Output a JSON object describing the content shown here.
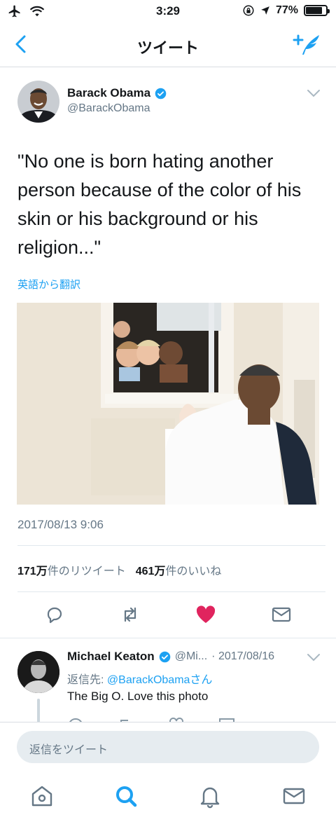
{
  "status": {
    "time": "3:29",
    "battery": "77%",
    "battery_level": 0.77
  },
  "nav": {
    "title": "ツイート"
  },
  "tweet": {
    "author_name": "Barack Obama",
    "author_handle": "@BarackObama",
    "text": "\"No one is born hating another person because of the color of his skin or his background or his religion...\"",
    "translate_label": "英語から翻訳",
    "timestamp": "2017/08/13 9:06",
    "retweets_count": "171万",
    "retweets_label": "件のリツイート",
    "likes_count": "461万",
    "likes_label": "件のいいね"
  },
  "reply": {
    "author_name": "Michael Keaton",
    "handle_truncated": "@Mi...",
    "date": "· 2017/08/16",
    "reply_prefix": "返信先: ",
    "reply_mention": "@BarackObamaさん",
    "text": "The Big O. Love this photo"
  },
  "composer": {
    "placeholder": "返信をツイート"
  },
  "colors": {
    "accent": "#1da1f2",
    "like": "#e0245e",
    "text": "#14171a",
    "muted": "#657786"
  },
  "icons": {
    "status_left": [
      "airplane-icon",
      "wifi-icon"
    ],
    "status_right": [
      "rotation-lock-icon",
      "location-arrow-icon",
      "battery-icon"
    ],
    "nav": [
      "back-chevron-icon",
      "compose-tweet-icon"
    ],
    "actions": [
      "reply-icon",
      "retweet-icon",
      "like-heart-icon",
      "direct-message-icon"
    ],
    "tabs": [
      "home-icon",
      "search-icon",
      "notifications-bell-icon",
      "messages-icon"
    ]
  }
}
